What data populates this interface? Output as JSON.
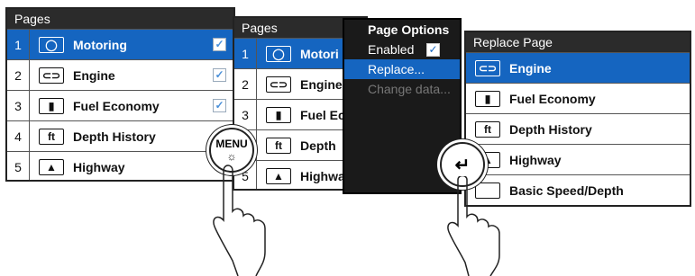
{
  "pages_panel_1": {
    "title": "Pages",
    "rows": [
      {
        "num": "1",
        "label": "Motoring",
        "icon": "motoring-icon",
        "glyph": "◯",
        "checked": true
      },
      {
        "num": "2",
        "label": "Engine",
        "icon": "engine-icon",
        "glyph": "⊂⊃",
        "checked": true
      },
      {
        "num": "3",
        "label": "Fuel Economy",
        "icon": "fuel-pump-icon",
        "glyph": "⛽",
        "checked": true
      },
      {
        "num": "4",
        "label": "Depth History",
        "icon": "depth-history-icon",
        "glyph": "ft",
        "checked": false
      },
      {
        "num": "5",
        "label": "Highway",
        "icon": "highway-icon",
        "glyph": "▟▙",
        "checked": false
      }
    ]
  },
  "pages_panel_2": {
    "title": "Pages",
    "rows": [
      {
        "num": "1",
        "label": "Motori"
      },
      {
        "num": "2",
        "label": "Engine"
      },
      {
        "num": "3",
        "label": "Fuel Ec"
      },
      {
        "num": "4",
        "label": "Depth"
      },
      {
        "num": "5",
        "label": "Highwa"
      }
    ]
  },
  "page_options": {
    "title": "Page Options",
    "enabled": "Enabled",
    "replace": "Replace...",
    "change_data": "Change data..."
  },
  "replace_page": {
    "title": "Replace Page",
    "rows": [
      {
        "label": "Engine"
      },
      {
        "label": "Fuel Economy"
      },
      {
        "label": "Depth History"
      },
      {
        "label": "Highway"
      },
      {
        "label": "Basic Speed/Depth"
      }
    ]
  },
  "menu_button": {
    "label": "MENU",
    "sub": "☼"
  },
  "enter_button": {
    "glyph": "↵"
  },
  "colors": {
    "accent": "#1565c0",
    "title_bar": "#2b2b2b"
  }
}
